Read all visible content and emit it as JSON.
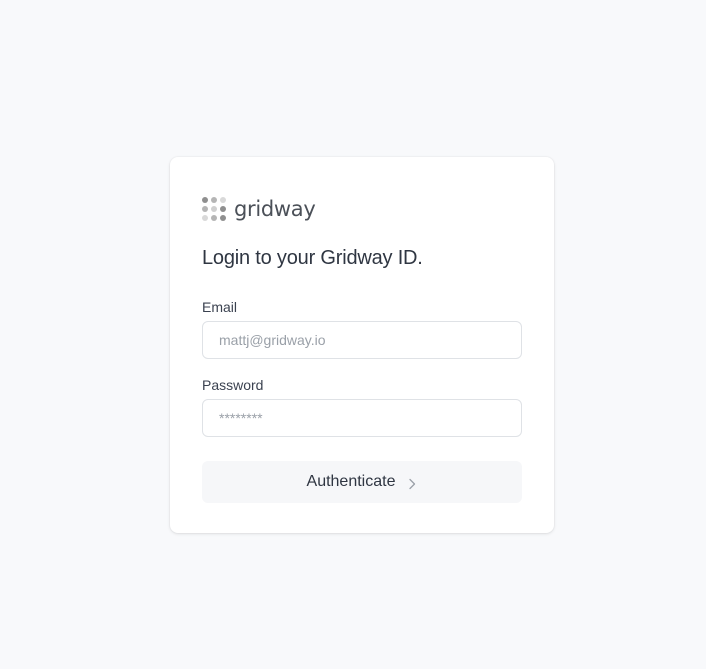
{
  "brand": {
    "name": "gridway",
    "logo_dot_colors": [
      "#8f8f8f",
      "#b5b5b5",
      "#d9d9d9",
      "#b5b5b5",
      "#d0d0d0",
      "#8f8f8f",
      "#d9d9d9",
      "#b5b5b5",
      "#8f8f8f"
    ]
  },
  "login": {
    "title": "Login to your Gridway ID.",
    "email_label": "Email",
    "email_placeholder": "mattj@gridway.io",
    "password_label": "Password",
    "password_placeholder": "********",
    "submit_label": "Authenticate",
    "submit_icon": "chevron-right-icon"
  },
  "colors": {
    "page_bg": "#f8f9fb",
    "card_bg": "#ffffff",
    "button_bg": "#f6f7f9",
    "text": "#2f3642",
    "placeholder": "#9aa0a8",
    "border": "#dfe2e6"
  }
}
